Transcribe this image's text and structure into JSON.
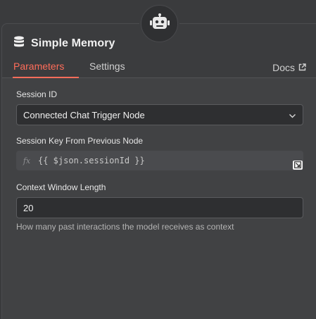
{
  "node": {
    "title": "Simple Memory",
    "badge_icon": "robot-icon",
    "title_icon": "database-icon"
  },
  "tabs": [
    {
      "label": "Parameters",
      "active": true
    },
    {
      "label": "Settings",
      "active": false
    }
  ],
  "docs": {
    "label": "Docs",
    "icon": "external-link-icon"
  },
  "fields": {
    "session_id": {
      "label": "Session ID",
      "value": "Connected Chat Trigger Node"
    },
    "session_key": {
      "label": "Session Key From Previous Node",
      "fx_label": "fx",
      "expression": "{{ $json.sessionId }}"
    },
    "context_window": {
      "label": "Context Window Length",
      "value": "20",
      "hint": "How many past interactions the model receives as context"
    }
  },
  "colors": {
    "accent": "#ff6d5a",
    "background": "#414244",
    "input_background": "#2e2f31"
  }
}
